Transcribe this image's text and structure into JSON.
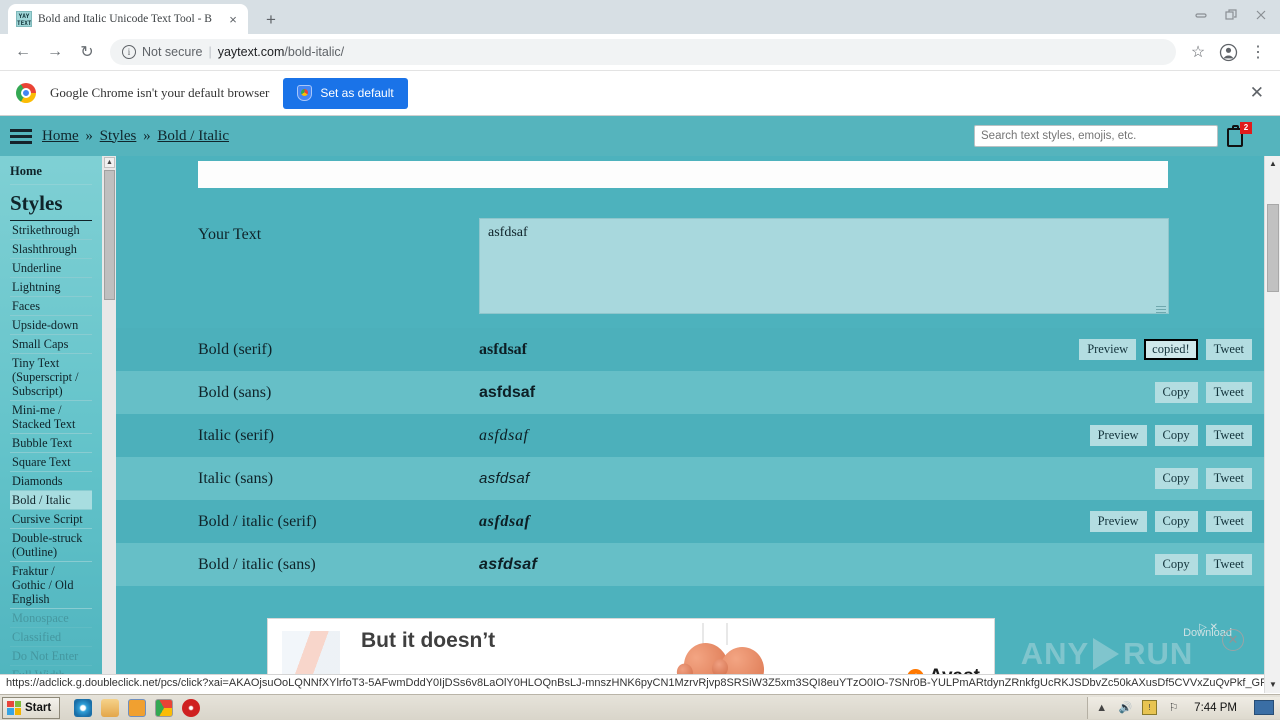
{
  "browser": {
    "tab": {
      "title": "Bold and Italic Unicode Text Tool - B",
      "favicon_text": "YAY TEXT",
      "close_icon": "×"
    },
    "new_tab_label": "+",
    "window_controls": {
      "minimize": "minimize-icon",
      "restore": "restore-icon",
      "close": "close-icon"
    },
    "nav": {
      "back": "←",
      "forward": "→",
      "reload": "↻"
    },
    "omnibox": {
      "info_glyph": "i",
      "security_label": "Not secure",
      "separator": "|",
      "url_domain": "yaytext.com",
      "url_path": "/bold-italic/"
    },
    "toolbar_icons": {
      "bookmark": "☆",
      "profile": "profile-icon",
      "menu": "⋮"
    },
    "infobar": {
      "message": "Google Chrome isn't your default browser",
      "button_label": "Set as default",
      "close_label": "✕"
    },
    "status_url": "https://adclick.g.doubleclick.net/pcs/click?xai=AKAOjsuOoLQNNfXYlrfoT3-5AFwmDddY0IjDSs6v8LaOlY0HLOQnBsLJ-mnszHNK6pyCN1MzrvRjvp8SRSiW3Z5xm3SQI8euYTzO0IO-7SNr0B-YULPmARtdynZRnkfgUcRKJSDbvZc50kAXusDf5CVVxZuQvPkf_GPIPZfmid..."
  },
  "site": {
    "breadcrumb": [
      {
        "label": "Home",
        "sep": "»"
      },
      {
        "label": "Styles",
        "sep": "»"
      },
      {
        "label": "Bold / Italic",
        "sep": ""
      }
    ],
    "search": {
      "placeholder": "Search text styles, emojis, etc.",
      "value": ""
    },
    "cart": {
      "icon": "clipboard-icon",
      "badge": "2"
    },
    "menu_icon": "hamburger-icon"
  },
  "sidebar": {
    "home_label": "Home",
    "section_title": "Styles",
    "items": [
      {
        "label": "Strikethrough",
        "active": false,
        "faded": false
      },
      {
        "label": "Slashthrough",
        "active": false,
        "faded": false
      },
      {
        "label": "Underline",
        "active": false,
        "faded": false
      },
      {
        "label": "Lightning",
        "active": false,
        "faded": false
      },
      {
        "label": "Faces",
        "active": false,
        "faded": false
      },
      {
        "label": "Upside-down",
        "active": false,
        "faded": false
      },
      {
        "label": "Small Caps",
        "active": false,
        "faded": false
      },
      {
        "label": "Tiny Text (Superscript / Subscript)",
        "active": false,
        "faded": false
      },
      {
        "label": "Mini-me / Stacked Text",
        "active": false,
        "faded": false
      },
      {
        "label": "Bubble Text",
        "active": false,
        "faded": false
      },
      {
        "label": "Square Text",
        "active": false,
        "faded": false
      },
      {
        "label": "Diamonds",
        "active": false,
        "faded": false
      },
      {
        "label": "Bold / Italic",
        "active": true,
        "faded": false
      },
      {
        "label": "Cursive Script",
        "active": false,
        "faded": false
      },
      {
        "label": "Double-struck (Outline)",
        "active": false,
        "faded": false
      },
      {
        "label": "Fraktur / Gothic / Old English",
        "active": false,
        "faded": false
      },
      {
        "label": "Monospace",
        "active": false,
        "faded": true
      },
      {
        "label": "Classified",
        "active": false,
        "faded": true
      },
      {
        "label": "Do Not Enter",
        "active": false,
        "faded": true
      },
      {
        "label": "Full Width",
        "active": false,
        "faded": true
      }
    ]
  },
  "main": {
    "input_label": "Your Text",
    "input_value": "asfdsaf",
    "rows": [
      {
        "label": "Bold (serif)",
        "sample": "asfdsaf",
        "preview": "Preview",
        "copy": "copied!",
        "copy_focused": true,
        "tweet": "Tweet"
      },
      {
        "label": "Bold (sans)",
        "sample": "asfdsaf",
        "preview": "",
        "copy": "Copy",
        "copy_focused": false,
        "tweet": "Tweet"
      },
      {
        "label": "Italic (serif)",
        "sample": "asfdsaf",
        "preview": "Preview",
        "copy": "Copy",
        "copy_focused": false,
        "tweet": "Tweet"
      },
      {
        "label": "Italic (sans)",
        "sample": "asfdsaf",
        "preview": "",
        "copy": "Copy",
        "copy_focused": false,
        "tweet": "Tweet"
      },
      {
        "label": "Bold / italic (serif)",
        "sample": "asfdsaf",
        "preview": "Preview",
        "copy": "Copy",
        "copy_focused": false,
        "tweet": "Tweet"
      },
      {
        "label": "Bold / italic (sans)",
        "sample": "asfdsaf",
        "preview": "",
        "copy": "Copy",
        "copy_focused": false,
        "tweet": "Tweet"
      }
    ]
  },
  "ad": {
    "headline": "But it doesn’t",
    "brand": "Avast",
    "download_label": "Download",
    "adchoices": "▷ ✕",
    "close_label": "✕",
    "watermark_left": "ANY",
    "watermark_right": "RUN"
  },
  "taskbar": {
    "start_label": "Start",
    "quick_launch": [
      "internet-explorer-icon",
      "folder-icon",
      "media-player-icon",
      "chrome-icon",
      "shutdown-icon"
    ],
    "tray_icons": [
      "chevron-up-icon",
      "volume-icon",
      "network-warning-icon",
      "flag-icon"
    ],
    "clock": "7:44 PM"
  },
  "colors": {
    "site_bg": "#4db2bd",
    "row_alt": "#66bfc7",
    "accent_blue": "#1a73e8",
    "badge_red": "#e01b1b"
  }
}
